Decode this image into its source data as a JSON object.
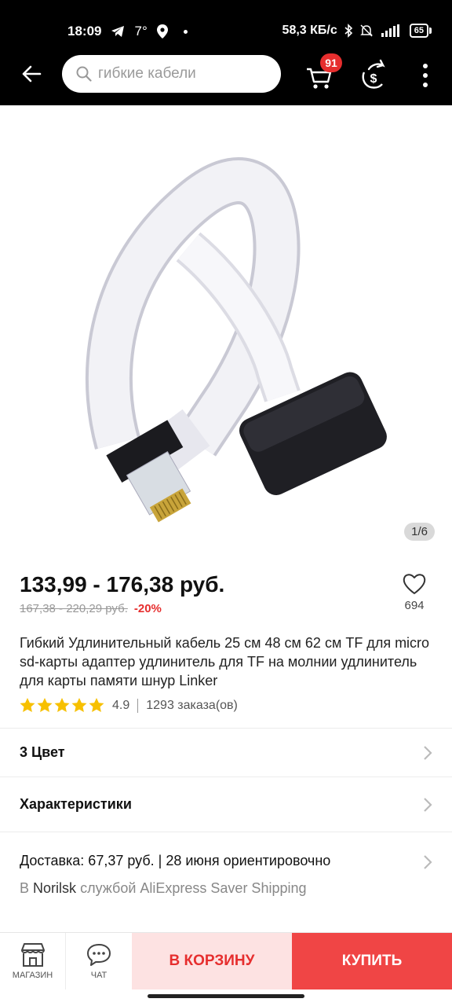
{
  "status_bar": {
    "time": "18:09",
    "temperature": "7°",
    "network_speed": "58,3 КБ/с",
    "battery": "65"
  },
  "header": {
    "search_placeholder": "гибкие кабели",
    "cart_count": "91"
  },
  "gallery": {
    "counter": "1/6"
  },
  "product": {
    "price": "133,99 - 176,38 руб.",
    "old_price": "167,38 - 220,29 руб.",
    "discount": "-20%",
    "wishlist_count": "694",
    "title": "Гибкий Удлинительный кабель 25 см 48 см 62 см TF для micro sd-карты адаптер удлинитель для TF на молнии удлинитель для карты памяти шнур Linker",
    "rating_stars": 5,
    "rating": "4.9",
    "orders": "1293 заказа(ов)"
  },
  "sections": {
    "color": "3 Цвет",
    "specs": "Характеристики",
    "delivery": "Доставка: 67,37 руб. | 28 июня ориентировочно",
    "delivery_prefix": "В",
    "delivery_city": "Norilsk",
    "delivery_service": "службой AliExpress Saver Shipping"
  },
  "bottom_bar": {
    "shop_label": "МАГАЗИН",
    "chat_label": "ЧАТ",
    "add_to_cart": "В КОРЗИНУ",
    "buy_now": "КУПИТЬ"
  },
  "colors": {
    "accent_red": "#e62e2e",
    "buy_button": "#f04545",
    "cart_button_bg": "#fde2e2",
    "star_yellow": "#f7c000"
  }
}
